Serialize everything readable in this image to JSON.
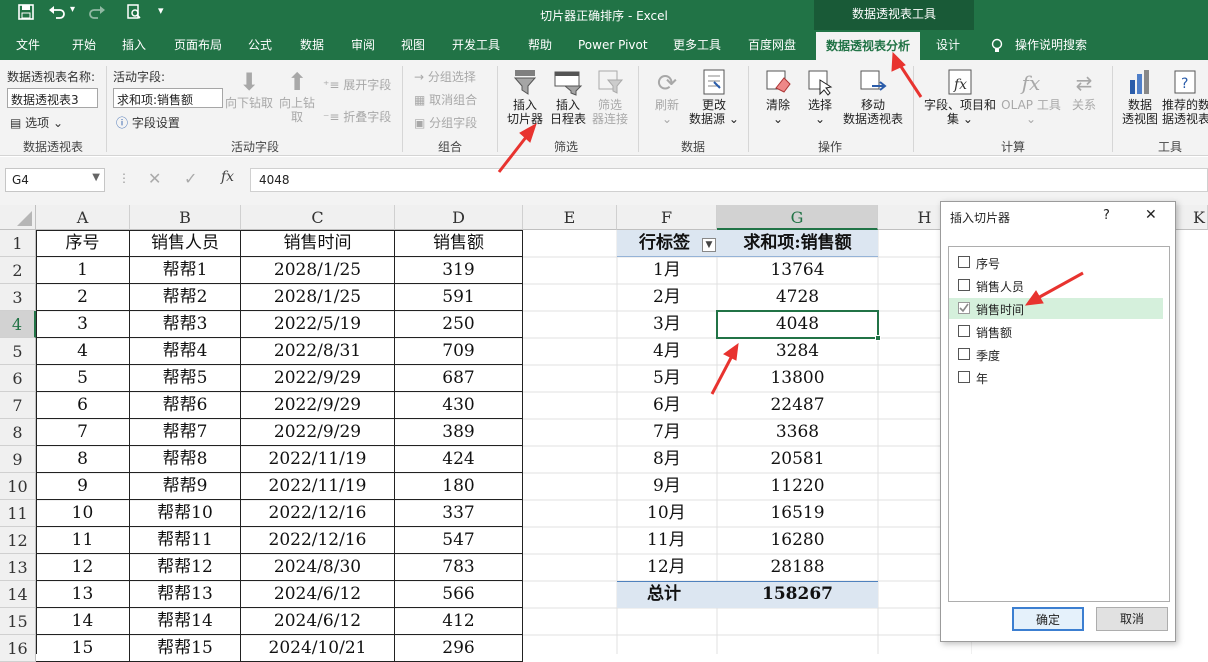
{
  "title_bar": {
    "doc_title": "切片器正确排序 - Excel",
    "context_tools": "数据透视表工具",
    "save_icon": "save-icon",
    "undo_icon": "undo-icon",
    "redo_icon": "redo-icon",
    "preview_icon": "print-preview-icon"
  },
  "tabs": [
    "文件",
    "开始",
    "插入",
    "页面布局",
    "公式",
    "数据",
    "审阅",
    "视图",
    "开发工具",
    "帮助",
    "Power Pivot",
    "更多工具",
    "百度网盘",
    "数据透视表分析",
    "设计",
    "操作说明搜索"
  ],
  "active_tab": "数据透视表分析",
  "ribbon": {
    "pivot_name_label": "数据透视表名称:",
    "pivot_name_value": "数据透视表3",
    "options_label": "选项",
    "group_pivot": "数据透视表",
    "active_field_label": "活动字段:",
    "active_field_value": "求和项:销售额",
    "field_settings": "字段设置",
    "drill_down": "向下钻取",
    "drill_up_1": "向上钻",
    "drill_up_2": "取",
    "expand_field": "展开字段",
    "collapse_field": "折叠字段",
    "group_active_field": "活动字段",
    "group_selection": "分组选择",
    "ungroup": "取消组合",
    "group_field": "分组字段",
    "group_group": "组合",
    "insert_slicer_1": "插入",
    "insert_slicer_2": "切片器",
    "insert_timeline_1": "插入",
    "insert_timeline_2": "日程表",
    "filter_connections_1": "筛选",
    "filter_connections_2": "器连接",
    "group_filter": "筛选",
    "refresh": "刷新",
    "change_source_1": "更改",
    "change_source_2": "数据源",
    "group_data": "数据",
    "clear": "清除",
    "select": "选择",
    "move_pivot_1": "移动",
    "move_pivot_2": "数据透视表",
    "group_actions": "操作",
    "fields_items_1": "字段、项目和",
    "fields_items_2": "集",
    "olap_tools": "OLAP 工具",
    "relationships": "关系",
    "group_calculations": "计算",
    "pivot_chart_1": "数据",
    "pivot_chart_2": "透视图",
    "recommended_1": "推荐的数",
    "recommended_2": "据透视表",
    "group_tools": "工具"
  },
  "formula_bar": {
    "name_box": "G4",
    "formula": "4048"
  },
  "columns": [
    "A",
    "B",
    "C",
    "D",
    "E",
    "F",
    "G",
    "H",
    "K"
  ],
  "rows": [
    "1",
    "2",
    "3",
    "4",
    "5",
    "6",
    "7",
    "8",
    "9",
    "10",
    "11",
    "12",
    "13",
    "14",
    "15",
    "16"
  ],
  "table": {
    "headers": [
      "序号",
      "销售人员",
      "销售时间",
      "销售额"
    ],
    "rows": [
      [
        "1",
        "帮帮1",
        "2028/1/25",
        "319"
      ],
      [
        "2",
        "帮帮2",
        "2028/1/25",
        "591"
      ],
      [
        "3",
        "帮帮3",
        "2022/5/19",
        "250"
      ],
      [
        "4",
        "帮帮4",
        "2022/8/31",
        "709"
      ],
      [
        "5",
        "帮帮5",
        "2022/9/29",
        "687"
      ],
      [
        "6",
        "帮帮6",
        "2022/9/29",
        "430"
      ],
      [
        "7",
        "帮帮7",
        "2022/9/29",
        "389"
      ],
      [
        "8",
        "帮帮8",
        "2022/11/19",
        "424"
      ],
      [
        "9",
        "帮帮9",
        "2022/11/19",
        "180"
      ],
      [
        "10",
        "帮帮10",
        "2022/12/16",
        "337"
      ],
      [
        "11",
        "帮帮11",
        "2022/12/16",
        "547"
      ],
      [
        "12",
        "帮帮12",
        "2024/8/30",
        "783"
      ],
      [
        "13",
        "帮帮13",
        "2024/6/12",
        "566"
      ],
      [
        "14",
        "帮帮14",
        "2024/6/12",
        "412"
      ],
      [
        "15",
        "帮帮15",
        "2024/10/21",
        "296"
      ]
    ]
  },
  "pivot": {
    "row_label_header": "行标签",
    "value_header": "求和项:销售额",
    "rows": [
      [
        "1月",
        "13764"
      ],
      [
        "2月",
        "4728"
      ],
      [
        "3月",
        "4048"
      ],
      [
        "4月",
        "3284"
      ],
      [
        "5月",
        "13800"
      ],
      [
        "6月",
        "22487"
      ],
      [
        "7月",
        "3368"
      ],
      [
        "8月",
        "20581"
      ],
      [
        "9月",
        "11220"
      ],
      [
        "10月",
        "16519"
      ],
      [
        "11月",
        "16280"
      ],
      [
        "12月",
        "28188"
      ]
    ],
    "total_label": "总计",
    "total_value": "158267"
  },
  "dialog": {
    "title": "插入切片器",
    "help": "?",
    "close": "✕",
    "fields": [
      {
        "label": "序号",
        "checked": false
      },
      {
        "label": "销售人员",
        "checked": false
      },
      {
        "label": "销售时间",
        "checked": true
      },
      {
        "label": "销售额",
        "checked": false
      },
      {
        "label": "季度",
        "checked": false
      },
      {
        "label": "年",
        "checked": false
      }
    ],
    "ok": "确定",
    "cancel": "取消"
  },
  "colors": {
    "excel_green": "#217346",
    "pivot_header_bg": "#dce6f1",
    "selected_field_bg": "#d5f0dc",
    "arrow_red": "#e8332f"
  }
}
